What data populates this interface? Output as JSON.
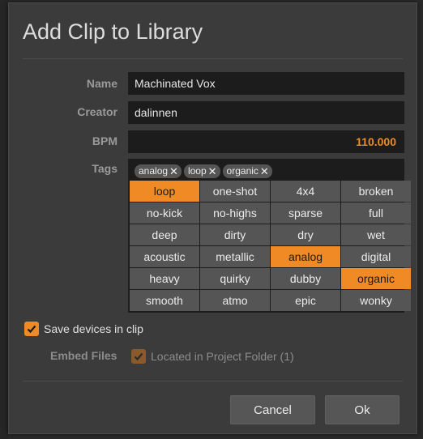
{
  "dialog": {
    "title": "Add Clip to Library",
    "name": {
      "label": "Name",
      "value": "Machinated Vox"
    },
    "creator": {
      "label": "Creator",
      "value": "dalinnen"
    },
    "bpm": {
      "label": "BPM",
      "value": "110.000"
    },
    "tags": {
      "label": "Tags",
      "selected": [
        "analog",
        "loop",
        "organic"
      ],
      "remove_glyph": "✕",
      "options": [
        {
          "label": "loop",
          "on": true
        },
        {
          "label": "one-shot",
          "on": false
        },
        {
          "label": "4x4",
          "on": false
        },
        {
          "label": "broken",
          "on": false
        },
        {
          "label": "no-kick",
          "on": false
        },
        {
          "label": "no-highs",
          "on": false
        },
        {
          "label": "sparse",
          "on": false
        },
        {
          "label": "full",
          "on": false
        },
        {
          "label": "deep",
          "on": false
        },
        {
          "label": "dirty",
          "on": false
        },
        {
          "label": "dry",
          "on": false
        },
        {
          "label": "wet",
          "on": false
        },
        {
          "label": "acoustic",
          "on": false
        },
        {
          "label": "metallic",
          "on": false
        },
        {
          "label": "analog",
          "on": true
        },
        {
          "label": "digital",
          "on": false
        },
        {
          "label": "heavy",
          "on": false
        },
        {
          "label": "quirky",
          "on": false
        },
        {
          "label": "dubby",
          "on": false
        },
        {
          "label": "organic",
          "on": true
        },
        {
          "label": "smooth",
          "on": false
        },
        {
          "label": "atmo",
          "on": false
        },
        {
          "label": "epic",
          "on": false
        },
        {
          "label": "wonky",
          "on": false
        }
      ]
    },
    "save_devices": {
      "label": "Save devices in clip",
      "checked": true
    },
    "embed_files": {
      "label": "Embed Files",
      "option_label": "Located in Project Folder (1)",
      "checked": true,
      "enabled": false
    },
    "buttons": {
      "cancel": "Cancel",
      "ok": "Ok"
    },
    "colors": {
      "accent": "#f08a24",
      "field_bg": "#1c1c1c",
      "tag_bg": "#555555",
      "dialog_bg": "#3b3b3b"
    }
  }
}
